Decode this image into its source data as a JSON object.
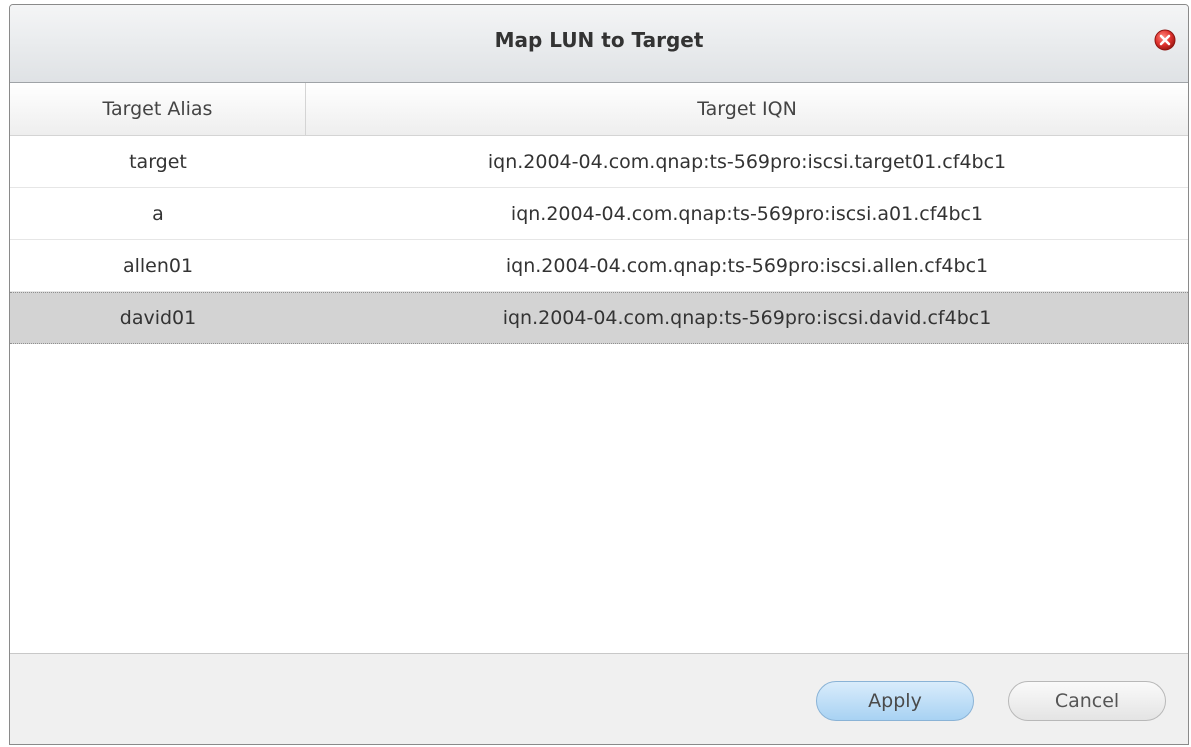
{
  "dialog": {
    "title": "Map LUN to Target",
    "close_icon": "close-circle-icon"
  },
  "table": {
    "columns": [
      "Target Alias",
      "Target IQN"
    ],
    "rows": [
      {
        "alias": "target",
        "iqn": "iqn.2004-04.com.qnap:ts-569pro:iscsi.target01.cf4bc1",
        "selected": false
      },
      {
        "alias": "a",
        "iqn": "iqn.2004-04.com.qnap:ts-569pro:iscsi.a01.cf4bc1",
        "selected": false
      },
      {
        "alias": "allen01",
        "iqn": "iqn.2004-04.com.qnap:ts-569pro:iscsi.allen.cf4bc1",
        "selected": false
      },
      {
        "alias": "david01",
        "iqn": "iqn.2004-04.com.qnap:ts-569pro:iscsi.david.cf4bc1",
        "selected": true
      }
    ]
  },
  "footer": {
    "apply_label": "Apply",
    "cancel_label": "Cancel"
  },
  "colors": {
    "close_red": "#e0322e",
    "selected_row": "#d3d3d3",
    "apply_blue": "#a8d2f3"
  }
}
